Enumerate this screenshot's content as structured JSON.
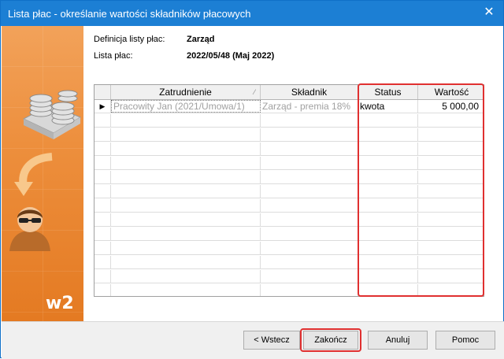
{
  "window": {
    "title": "Lista płac - określanie wartości składników płacowych",
    "close_glyph": "✕"
  },
  "sidebar": {
    "badge": "w2",
    "icons": [
      "coins-tray-icon",
      "curved-arrow-icon",
      "user-sunglasses-icon"
    ]
  },
  "info": {
    "definition_label": "Definicja listy płac:",
    "definition_value": "Zarząd",
    "list_label": "Lista płac:",
    "list_value": "2022/05/48 (Maj 2022)"
  },
  "grid": {
    "columns": [
      "Zatrudnienie",
      "Składnik",
      "Status",
      "Wartość"
    ],
    "row_indicator": "▶",
    "rows": [
      {
        "employee": "Pracowity Jan (2021/Umowa/1)",
        "component": "Zarząd - premia 18%",
        "status": "kwota",
        "value": "5 000,00"
      }
    ]
  },
  "buttons": {
    "back": "< Wstecz",
    "finish": "Zakończ",
    "cancel": "Anuluj",
    "help": "Pomoc"
  },
  "colors": {
    "titlebar": "#1c7fd4",
    "sidebar": "#ed8f3d",
    "highlight": "#e03030"
  }
}
